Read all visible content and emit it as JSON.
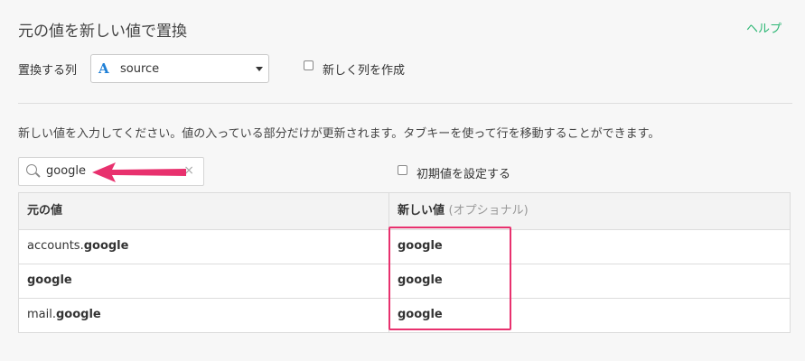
{
  "header": {
    "title": "元の値を新しい値で置換",
    "help_label": "ヘルプ"
  },
  "column_select": {
    "label": "置換する列",
    "type_icon": "A",
    "value": "source"
  },
  "new_column": {
    "label": "新しく列を作成",
    "checked": false
  },
  "description": "新しい値を入力してください。値の入っている部分だけが更新されます。タブキーを使って行を移動することができます。",
  "search": {
    "value": "google",
    "clear_icon": "×"
  },
  "initial_value": {
    "label": "初期値を設定する",
    "checked": false
  },
  "table": {
    "headers": {
      "original": "元の値",
      "new": "新しい値",
      "new_hint": "(オプショナル)"
    },
    "rows": [
      {
        "orig_prefix": "accounts.",
        "orig_match": "google",
        "new_value": "google"
      },
      {
        "orig_prefix": "",
        "orig_match": "google",
        "new_value": "google"
      },
      {
        "orig_prefix": "mail.",
        "orig_match": "google",
        "new_value": "google"
      }
    ]
  },
  "colors": {
    "accent": "#2bb673",
    "annotation": "#e8316e",
    "type_icon": "#1e7fd6"
  }
}
